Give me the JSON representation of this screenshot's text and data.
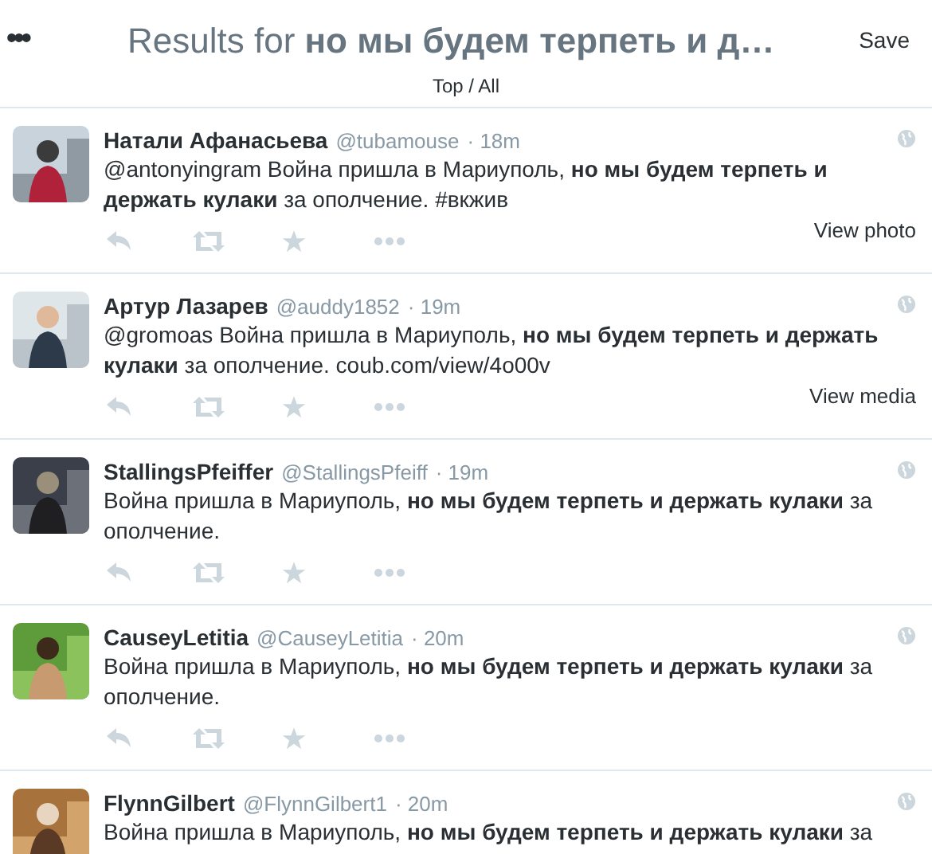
{
  "header": {
    "menu": "•••",
    "title_prefix": "Results for ",
    "query": "но мы будем терпеть и д…",
    "save": "Save",
    "filter": "Top / All"
  },
  "tweets": [
    {
      "name": "Натали Афанасьева",
      "handle": "@tubamouse",
      "time": "· 18m",
      "text": "@antonyingram Война пришла в Мариуполь, **но мы будем терпеть и держать кулаки** за ополчение.  #вкжив",
      "media": "View photo"
    },
    {
      "name": "Артур Лазарев",
      "handle": "@auddy1852",
      "time": "· 19m",
      "text": "@gromoas Война пришла в Мариуполь, **но мы будем терпеть и держать кулаки** за ополчение. coub.com/view/4o00v",
      "media": "View media"
    },
    {
      "name": "StallingsPfeiffer",
      "handle": "@StallingsPfeiff",
      "time": "· 19m",
      "text": "Война пришла в Мариуполь, **но мы будем терпеть и держать кулаки** за ополчение."
    },
    {
      "name": "CauseyLetitia",
      "handle": "@CauseyLetitia",
      "time": "· 20m",
      "text": "Война пришла в Мариуполь, **но мы будем терпеть и держать кулаки** за ополчение."
    },
    {
      "name": "FlynnGilbert",
      "handle": "@FlynnGilbert1",
      "time": "· 20m",
      "text": "Война пришла в Мариуполь, **но мы будем терпеть и держать кулаки** за"
    }
  ]
}
